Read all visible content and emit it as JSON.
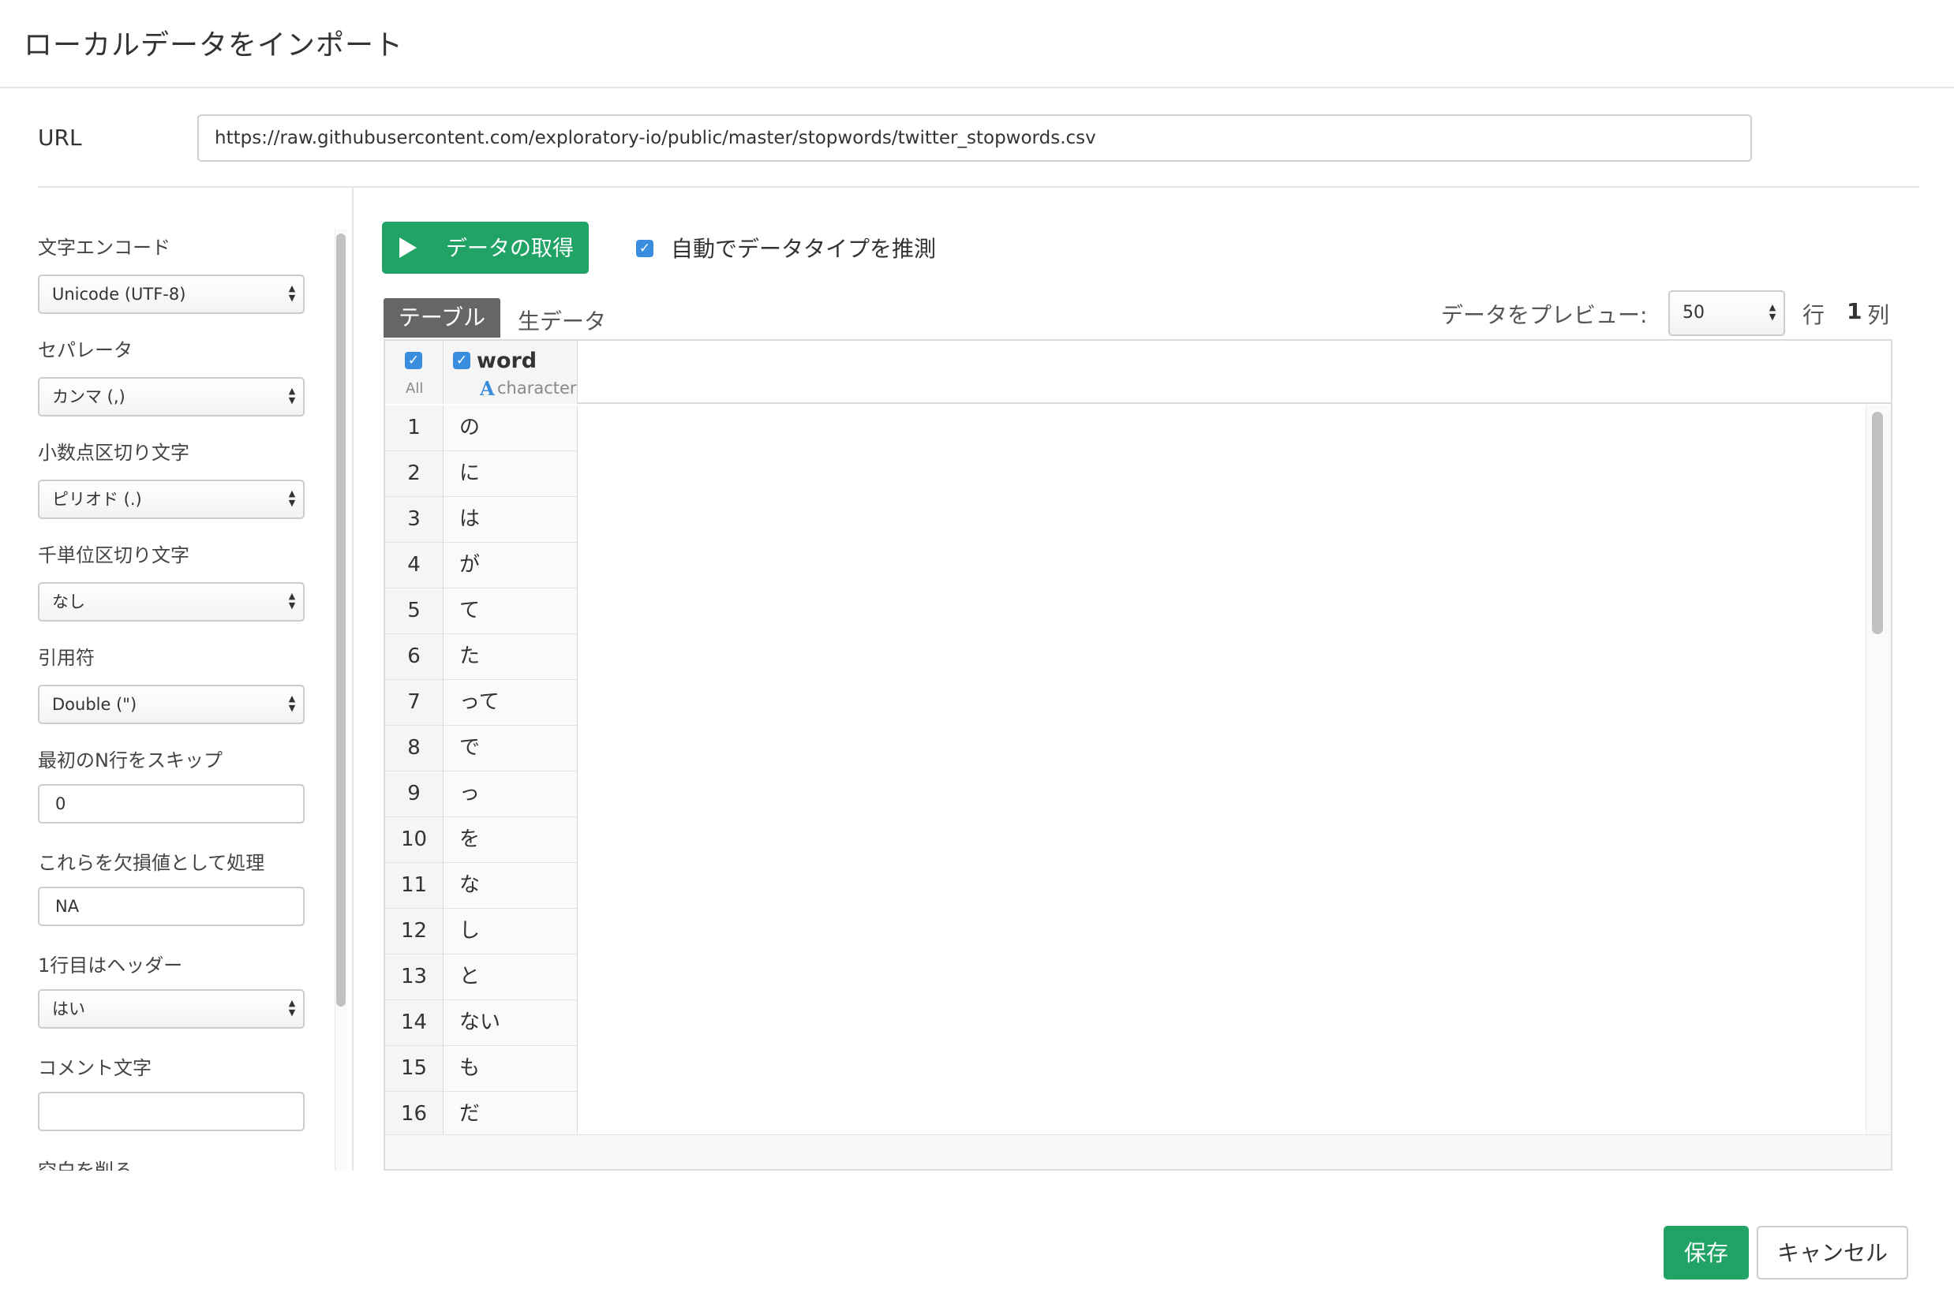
{
  "dialog": {
    "title": "ローカルデータをインポート"
  },
  "url": {
    "label": "URL",
    "value": "https://raw.githubusercontent.com/exploratory-io/public/master/stopwords/twitter_stopwords.csv"
  },
  "settings": {
    "encoding": {
      "label": "文字エンコード",
      "value": "Unicode (UTF-8)"
    },
    "separator": {
      "label": "セパレータ",
      "value": "カンマ (,)"
    },
    "decimal": {
      "label": "小数点区切り文字",
      "value": "ピリオド (.)"
    },
    "thousands": {
      "label": "千単位区切り文字",
      "value": "なし"
    },
    "quote": {
      "label": "引用符",
      "value": "Double (\")"
    },
    "skip_rows": {
      "label": "最初のN行をスキップ",
      "value": "0"
    },
    "na_values": {
      "label": "これらを欠損値として処理",
      "value": "NA"
    },
    "header": {
      "label": "1行目はヘッダー",
      "value": "はい"
    },
    "comment": {
      "label": "コメント文字",
      "value": ""
    },
    "trim": {
      "label": "空白を削る"
    }
  },
  "toolbar": {
    "fetch_label": "データの取得",
    "auto_detect_label": "自動でデータタイプを推測",
    "auto_detect_checked": true
  },
  "tabs": {
    "table": "テーブル",
    "raw": "生データ"
  },
  "preview": {
    "label": "データをプレビュー:",
    "value": "50",
    "rows_label": "行",
    "cols_count": "1",
    "cols_label": "列"
  },
  "grid": {
    "all_label": "All",
    "column": {
      "name": "word",
      "type": "character",
      "type_icon": "A"
    },
    "rows": [
      {
        "num": "1",
        "word": "の"
      },
      {
        "num": "2",
        "word": "に"
      },
      {
        "num": "3",
        "word": "は"
      },
      {
        "num": "4",
        "word": "が"
      },
      {
        "num": "5",
        "word": "て"
      },
      {
        "num": "6",
        "word": "た"
      },
      {
        "num": "7",
        "word": "って"
      },
      {
        "num": "8",
        "word": "で"
      },
      {
        "num": "9",
        "word": "っ"
      },
      {
        "num": "10",
        "word": "を"
      },
      {
        "num": "11",
        "word": "な"
      },
      {
        "num": "12",
        "word": "し"
      },
      {
        "num": "13",
        "word": "と"
      },
      {
        "num": "14",
        "word": "ない"
      },
      {
        "num": "15",
        "word": "も"
      },
      {
        "num": "16",
        "word": "だ"
      }
    ]
  },
  "footer": {
    "save_label": "保存",
    "cancel_label": "キャンセル"
  },
  "colors": {
    "primary": "#21a366",
    "accent": "#3a8dde"
  }
}
